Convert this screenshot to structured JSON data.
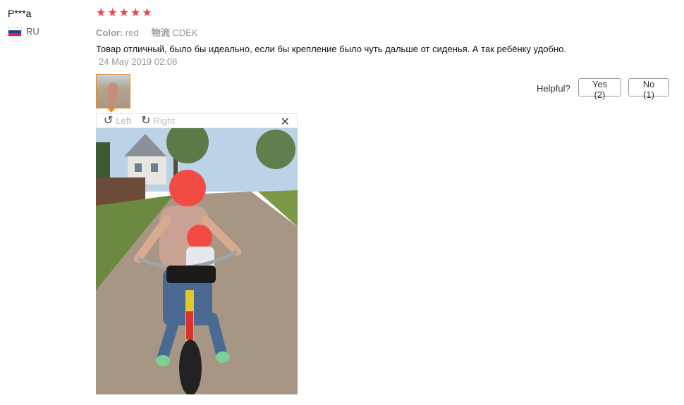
{
  "reviewer": {
    "name": "P***a",
    "country": "RU",
    "flag_colors": [
      "#ffffff",
      "#1c3fa8",
      "#e0262b"
    ]
  },
  "rating": {
    "value": 5,
    "max": 5,
    "star_color": "#f0444d"
  },
  "attributes": {
    "color_label": "Color:",
    "color_value": "red",
    "logistics_label": "物流",
    "logistics_value": "CDEK"
  },
  "review": {
    "text": "Товар отличный, было бы идеально, если бы крепление было чуть дальше от сиденья. А так ребёнку удобно.",
    "date": "24 May 2019 02:08"
  },
  "helpful": {
    "label": "Helpful?",
    "yes_label": "Yes (2)",
    "no_label": "No (1)"
  },
  "viewer": {
    "rotate_left_label": "Left",
    "rotate_right_label": "Right",
    "rotate_left_icon": "rotate-ccw-icon",
    "rotate_right_icon": "rotate-cw-icon",
    "close_icon": "close-icon",
    "accent_color": "#f08a24"
  }
}
